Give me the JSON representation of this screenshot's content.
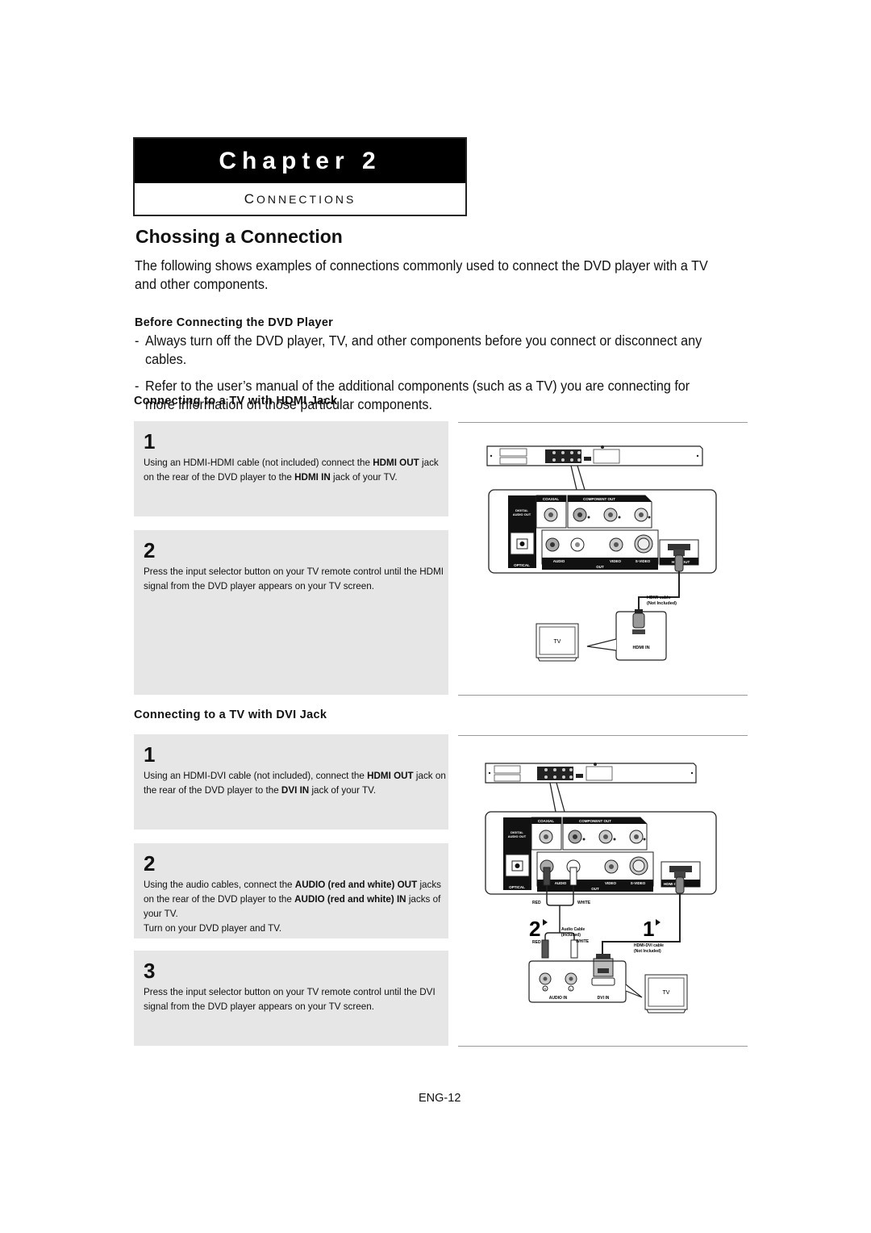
{
  "chapter": {
    "label": "Chapter 2",
    "subtitle_first": "C",
    "subtitle_rest": "ONNECTIONS"
  },
  "page_title": "Chossing a Connection",
  "intro": "The following shows examples of connections commonly used to connect the DVD player with a TV and other components.",
  "before": {
    "heading": "Before Connecting the DVD Player",
    "bullets": [
      "Always turn off the DVD player, TV, and other components before you connect or disconnect any cables.",
      "Refer to the user’s manual of the additional components (such as a TV) you are connecting for more information on those particular components."
    ]
  },
  "hdmi_section": {
    "heading": "Connecting to a TV with HDMI Jack",
    "steps": [
      {
        "number": "1",
        "parts": [
          "Using an HDMI-HDMI cable (not included) connect the ",
          "HDMI OUT",
          " jack on the rear of the DVD player to the ",
          "HDMI IN",
          " jack of your TV."
        ]
      },
      {
        "number": "2",
        "text": "Press the input selector button on your TV remote control until the HDMI signal from the DVD player appears on your TV screen."
      }
    ],
    "diagram": {
      "panel_labels": {
        "coaxial": "COAXIAL",
        "component_out": "COMPONENT OUT",
        "digital_audio_out_1": "DIGITAL",
        "digital_audio_out_2": "AUDIO OUT",
        "optical": "OPTICAL",
        "audio": "AUDIO",
        "video": "VIDEO",
        "s_video": "S-VIDEO",
        "out": "OUT",
        "hdmi_out": "HDMI OUT"
      },
      "cable_label_1": "HDMI cable",
      "cable_label_2": "(Not Included)",
      "tv_label": "TV",
      "jack_label": "HDMI IN"
    }
  },
  "dvi_section": {
    "heading": "Connecting to a TV with DVI Jack",
    "steps": [
      {
        "number": "1",
        "parts": [
          "Using an HDMI-DVI cable (not included), connect the ",
          "HDMI OUT",
          " jack on the rear of the DVD player to the ",
          "DVI IN",
          "  jack of your TV."
        ]
      },
      {
        "number": "2",
        "parts": [
          "Using the audio cables, connect the ",
          "AUDIO (red and white) OUT",
          " jacks on the rear of the DVD player to the ",
          "AUDIO (red and white) IN",
          " jacks of your TV."
        ],
        "extra": "Turn on your DVD player and TV."
      },
      {
        "number": "3",
        "text": "Press the input selector button on your TV remote control until the DVI signal from the DVD player appears on your TV screen."
      }
    ],
    "diagram": {
      "red": "RED",
      "white": "WHITE",
      "audio_cable_1": "Audio Cable",
      "audio_cable_2": "(Included)",
      "dvi_cable_1": "HDMI-DVI cable",
      "dvi_cable_2": "(Not Included)",
      "step_marker_2": "2",
      "step_marker_1": "1",
      "r": "R",
      "l": "L",
      "audio_in": "AUDIO IN",
      "dvi_in": "DVI IN",
      "tv_label": "TV"
    }
  },
  "page_number": "ENG-12"
}
